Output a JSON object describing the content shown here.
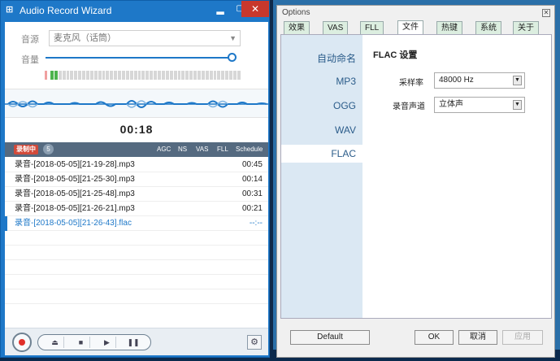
{
  "recorder": {
    "title": "Audio Record Wizard",
    "window_controls": {
      "min": "▂",
      "max": "▢",
      "close": "✕"
    },
    "source_label": "音源",
    "source_value": "麦克风（话筒）",
    "volume_label": "音量",
    "volume_level": 0.98,
    "timer": "00:18",
    "status_badge": "录制中",
    "file_count": "5",
    "columns": [
      "AGC",
      "NS",
      "VAS",
      "FLL",
      "Schedule"
    ],
    "files": [
      {
        "name": "录音-[2018-05-05][21-19-28].mp3",
        "duration": "00:45"
      },
      {
        "name": "录音-[2018-05-05][21-25-30].mp3",
        "duration": "00:14"
      },
      {
        "name": "录音-[2018-05-05][21-25-48].mp3",
        "duration": "00:31"
      },
      {
        "name": "录音-[2018-05-05][21-26-21].mp3",
        "duration": "00:21"
      },
      {
        "name": "录音-[2018-05-05][21-26-43].flac",
        "duration": "--:--"
      }
    ]
  },
  "options": {
    "title": "Options",
    "tabs": [
      "效果",
      "VAS",
      "FLL",
      "文件",
      "热键",
      "系统",
      "关于"
    ],
    "active_tab": "文件",
    "sidenav": [
      "自动命名",
      "MP3",
      "OGG",
      "WAV",
      "FLAC"
    ],
    "active_nav": "FLAC",
    "panel_title": "FLAC 设置",
    "sample_rate_label": "采样率",
    "sample_rate_value": "48000 Hz",
    "channel_label": "录音声道",
    "channel_value": "立体声",
    "buttons": {
      "default": "Default",
      "ok": "OK",
      "cancel": "取消",
      "apply": "应用"
    }
  },
  "colors": {
    "accent": "#1e78c8",
    "close": "#c8382c",
    "record": "#e0302a"
  }
}
